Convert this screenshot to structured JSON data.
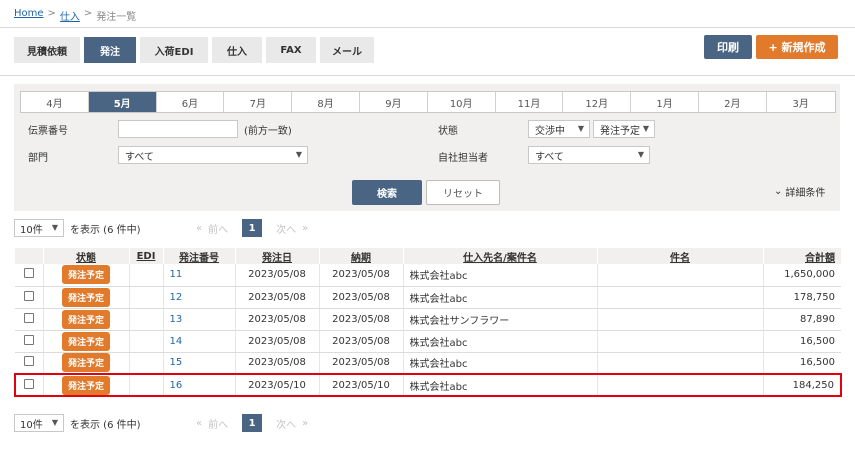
{
  "breadcrumb": {
    "home": "Home",
    "sep1": ">",
    "purchase": "仕入",
    "sep2": ">",
    "current": "発注一覧"
  },
  "tabs": [
    "見積依頼",
    "発注",
    "入荷EDI",
    "仕入",
    "FAX",
    "メール"
  ],
  "actions": {
    "print": "印刷",
    "new": "+ 新規作成"
  },
  "months": [
    "4月",
    "5月",
    "6月",
    "7月",
    "8月",
    "9月",
    "10月",
    "11月",
    "12月",
    "1月",
    "2月",
    "3月"
  ],
  "filters": {
    "slip_label": "伝票番号",
    "slip_value": "",
    "slip_note": "(前方一致)",
    "dept_label": "部門",
    "dept_value": "すべて",
    "status_label": "状態",
    "status_value1": "交渉中",
    "status_value2": "発注予定",
    "staff_label": "自社担当者",
    "staff_value": "すべて",
    "search": "検索",
    "reset": "リセット",
    "detail": "詳細条件"
  },
  "pager": {
    "per_page": "10件",
    "display_text": "を表示 (6 件中)",
    "first": "«",
    "prev": "前へ",
    "current": "1",
    "next": "次へ",
    "last": "»"
  },
  "table": {
    "headers": [
      "状態",
      "EDI",
      "発注番号",
      "発注日",
      "納期",
      "仕入先名/案件名",
      "件名",
      "合計額"
    ],
    "rows": [
      {
        "status": "発注予定",
        "edi": "",
        "number": "11",
        "order_date": "2023/05/08",
        "due": "2023/05/08",
        "supplier": "株式会社abc",
        "subject": "",
        "total": "1,650,000"
      },
      {
        "status": "発注予定",
        "edi": "",
        "number": "12",
        "order_date": "2023/05/08",
        "due": "2023/05/08",
        "supplier": "株式会社abc",
        "subject": "",
        "total": "178,750"
      },
      {
        "status": "発注予定",
        "edi": "",
        "number": "13",
        "order_date": "2023/05/08",
        "due": "2023/05/08",
        "supplier": "株式会社サンフラワー",
        "subject": "",
        "total": "87,890"
      },
      {
        "status": "発注予定",
        "edi": "",
        "number": "14",
        "order_date": "2023/05/08",
        "due": "2023/05/08",
        "supplier": "株式会社abc",
        "subject": "",
        "total": "16,500"
      },
      {
        "status": "発注予定",
        "edi": "",
        "number": "15",
        "order_date": "2023/05/08",
        "due": "2023/05/08",
        "supplier": "株式会社abc",
        "subject": "",
        "total": "16,500"
      },
      {
        "status": "発注予定",
        "edi": "",
        "number": "16",
        "order_date": "2023/05/10",
        "due": "2023/05/10",
        "supplier": "株式会社abc",
        "subject": "",
        "total": "184,250"
      }
    ]
  },
  "colors": {
    "accent": "#4a6584",
    "orange": "#e27a2c",
    "highlight": "#e3000f"
  }
}
